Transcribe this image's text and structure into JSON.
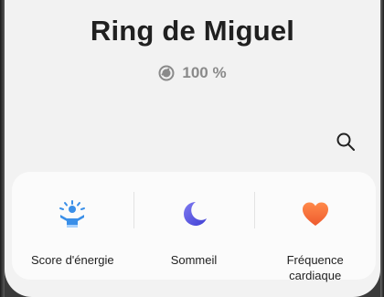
{
  "header": {
    "title": "Ring de Miguel",
    "battery_text": "100 %",
    "battery_icon": "ring-battery-icon"
  },
  "toolbar": {
    "search_icon": "search-icon"
  },
  "metrics": [
    {
      "label": "Score d'énergie",
      "icon": "energy-person-icon",
      "color": "#3a8fe8"
    },
    {
      "label": "Sommeil",
      "icon": "moon-icon",
      "color": "#5a58e0"
    },
    {
      "label": "Fréquence cardiaque",
      "icon": "heart-icon",
      "color": "#f06a3c"
    }
  ]
}
